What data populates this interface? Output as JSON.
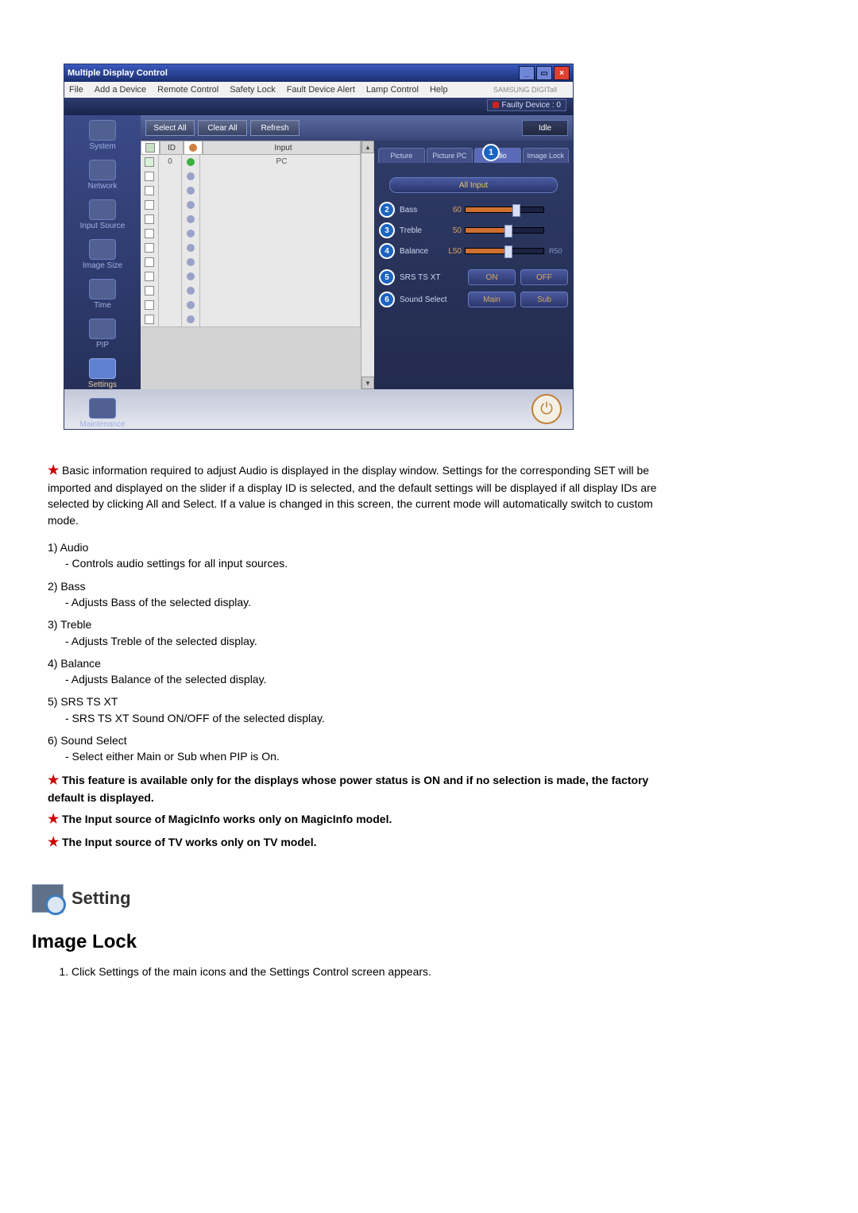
{
  "window": {
    "title": "Multiple Display Control",
    "brand": "SAMSUNG DIGITall"
  },
  "menu": {
    "file": "File",
    "add": "Add a Device",
    "remote": "Remote Control",
    "safety": "Safety Lock",
    "fault": "Fault Device Alert",
    "lamp": "Lamp Control",
    "help": "Help"
  },
  "strip": {
    "faulty": "Faulty Device : 0"
  },
  "sidebar": {
    "items": [
      {
        "label": "System"
      },
      {
        "label": "Network"
      },
      {
        "label": "Input Source"
      },
      {
        "label": "Image Size"
      },
      {
        "label": "Time"
      },
      {
        "label": "PIP"
      },
      {
        "label": "Settings"
      },
      {
        "label": "Maintenance"
      }
    ]
  },
  "buttons": {
    "selectAll": "Select All",
    "clearAll": "Clear All",
    "refresh": "Refresh",
    "idle": "Idle"
  },
  "grid": {
    "head": {
      "id": "ID",
      "input": "Input"
    },
    "row0": {
      "id": "0",
      "input": "PC"
    }
  },
  "tabs": {
    "picture": "Picture",
    "picturePC": "Picture PC",
    "audio": "Audio",
    "imageLock": "Image Lock"
  },
  "panel": {
    "allInput": "All Input",
    "bass": {
      "label": "Bass",
      "val": "60"
    },
    "treble": {
      "label": "Treble",
      "val": "50"
    },
    "balance": {
      "label": "Balance",
      "lval": "L50",
      "rval": "R50"
    },
    "srs": {
      "label": "SRS TS XT",
      "on": "ON",
      "off": "OFF"
    },
    "sound": {
      "label": "Sound Select",
      "main": "Main",
      "sub": "Sub"
    },
    "b1": "1",
    "b2": "2",
    "b3": "3",
    "b4": "4",
    "b5": "5",
    "b6": "6"
  },
  "doc": {
    "intro": "Basic information required to adjust Audio is displayed in the display window. Settings for the corresponding SET will be imported and displayed on the slider if a display ID is selected, and the default settings will be displayed if all display IDs are selected by clicking All and Select. If a value is changed in this screen, the current mode will automatically switch to custom mode.",
    "n1": "1) Audio",
    "d1": "- Controls audio settings for all input sources.",
    "n2": "2) Bass",
    "d2": "- Adjusts Bass of the selected display.",
    "n3": "3) Treble",
    "d3": "- Adjusts Treble of the selected display.",
    "n4": "4) Balance",
    "d4": "- Adjusts Balance of the selected display.",
    "n5": "5) SRS TS XT",
    "d5": "- SRS TS XT Sound ON/OFF of the selected display.",
    "n6": "6) Sound Select",
    "d6": "- Select either Main or Sub when PIP is On.",
    "note1": "This feature is available only for the displays whose power status is ON and if no selection is made, the factory default is displayed.",
    "note2": "The Input source of MagicInfo works only on MagicInfo model.",
    "note3": "The Input source of TV works only on TV model.",
    "settingTitle": "Setting",
    "ilTitle": "Image Lock",
    "step1": "Click Settings of the main icons and the Settings Control screen appears."
  }
}
